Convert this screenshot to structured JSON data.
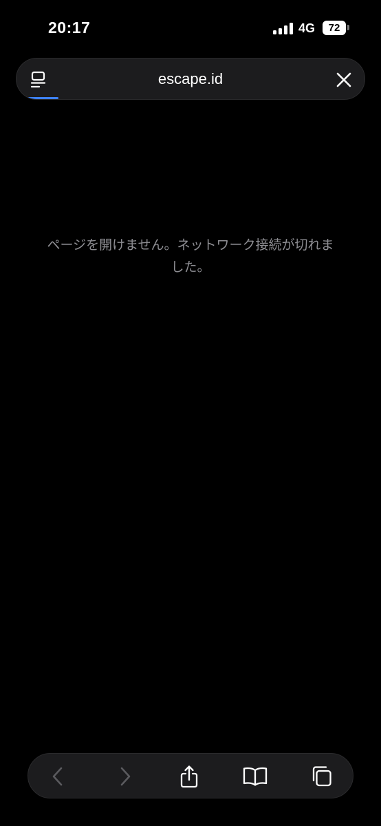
{
  "status_bar": {
    "time": "20:17",
    "network": "4G",
    "battery": "72"
  },
  "url_bar": {
    "url": "escape.id",
    "load_progress": 0.12
  },
  "page": {
    "error_message": "ページを開けません。ネットワーク接続が切れました。"
  },
  "toolbar": {
    "buttons": [
      "back-icon",
      "forward-icon",
      "share-icon",
      "bookmarks-icon",
      "tabs-icon"
    ]
  },
  "colors": {
    "background": "#000000",
    "bar": "#1c1c1e",
    "accent": "#3e82f7",
    "muted_text": "#8e8e93",
    "disabled_icon": "#5a5a5e"
  }
}
